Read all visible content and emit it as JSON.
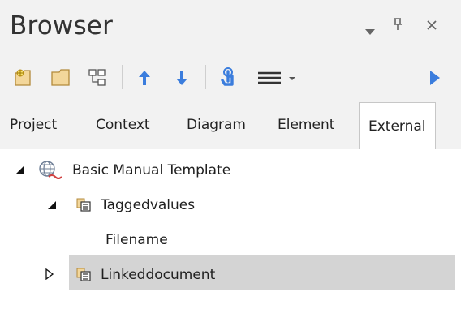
{
  "panel": {
    "title": "Browser"
  },
  "window_controls": {
    "dropdown_glyph": "▼",
    "pin_glyph": "ᛏ",
    "close_glyph": "×"
  },
  "toolbar": {
    "icons": [
      "new-package-icon",
      "new-folder-icon",
      "new-diagram-icon",
      "move-up-icon",
      "move-down-icon",
      "touch-icon",
      "menu-icon",
      "run-icon"
    ]
  },
  "tabs": [
    {
      "label": "Project"
    },
    {
      "label": "Context"
    },
    {
      "label": "Diagram"
    },
    {
      "label": "Element"
    },
    {
      "label": "External",
      "active": true
    }
  ],
  "tree": {
    "nodes": [
      {
        "label": "Basic Manual Template",
        "expanded": true,
        "level": 0
      },
      {
        "label": "Taggedvalues",
        "expanded": true,
        "level": 1
      },
      {
        "label": "Filename",
        "level": 2
      },
      {
        "label": "Linkeddocument",
        "expanded": false,
        "level": 1,
        "selected": true
      }
    ]
  },
  "colors": {
    "background": "#f2f2f2",
    "tree_background": "#ffffff",
    "selection": "#d4d4d4",
    "toolbar_arrow": "#3b7ddd",
    "folder": "#e7c27a"
  }
}
